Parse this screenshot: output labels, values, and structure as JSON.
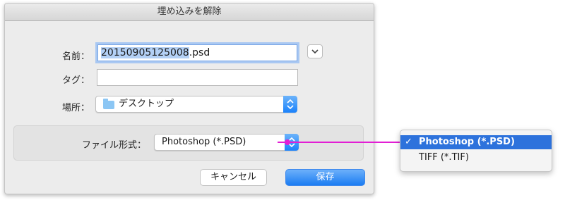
{
  "dialog": {
    "title": "埋め込みを解除",
    "name_label": "名前：",
    "name_selected": "20150905125008",
    "name_ext": ".psd",
    "tags_label": "タグ：",
    "tags_value": "",
    "location_label": "場所：",
    "location_value": "デスクトップ",
    "format_label": "ファイル形式：",
    "format_value": "Photoshop (*.PSD)",
    "cancel_label": "キャンセル",
    "save_label": "保存"
  },
  "format_menu": {
    "items": [
      {
        "label": "Photoshop (*.PSD)",
        "checked": true,
        "check": "✓"
      },
      {
        "label": "TIFF (*.TIF)",
        "checked": false
      }
    ]
  },
  "colors": {
    "accent": "#1b7cf2",
    "highlight": "#2d72dc",
    "annotation_line": "#e21fd4"
  },
  "icons": {
    "expand": "chevron-down-icon",
    "location": "folder-icon",
    "popup": "updown-arrows-icon"
  }
}
